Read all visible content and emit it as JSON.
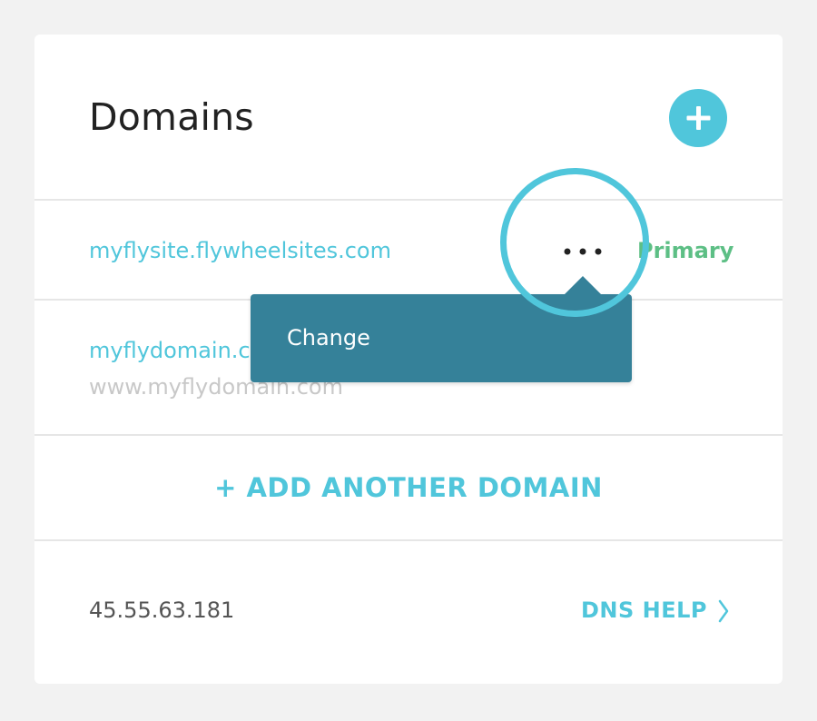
{
  "header": {
    "title": "Domains",
    "add_button_icon": "plus-icon"
  },
  "domains": [
    {
      "name": "myflysite.flywheelsites.com",
      "status": "Primary",
      "menu_icon": "ellipsis-icon"
    },
    {
      "name": "myflydomain.c",
      "alias": "www.myflydomain.com"
    }
  ],
  "popover": {
    "items": [
      {
        "label": "Change"
      }
    ]
  },
  "add_domain_label": "+ ADD ANOTHER DOMAIN",
  "footer": {
    "ip": "45.55.63.181",
    "dns_help_label": "DNS HELP",
    "dns_help_icon": "chevron-right-icon"
  },
  "colors": {
    "accent": "#50c6db",
    "primary_status": "#5dbf85",
    "popover_bg": "#358199",
    "muted_text": "#c8c8c8"
  }
}
